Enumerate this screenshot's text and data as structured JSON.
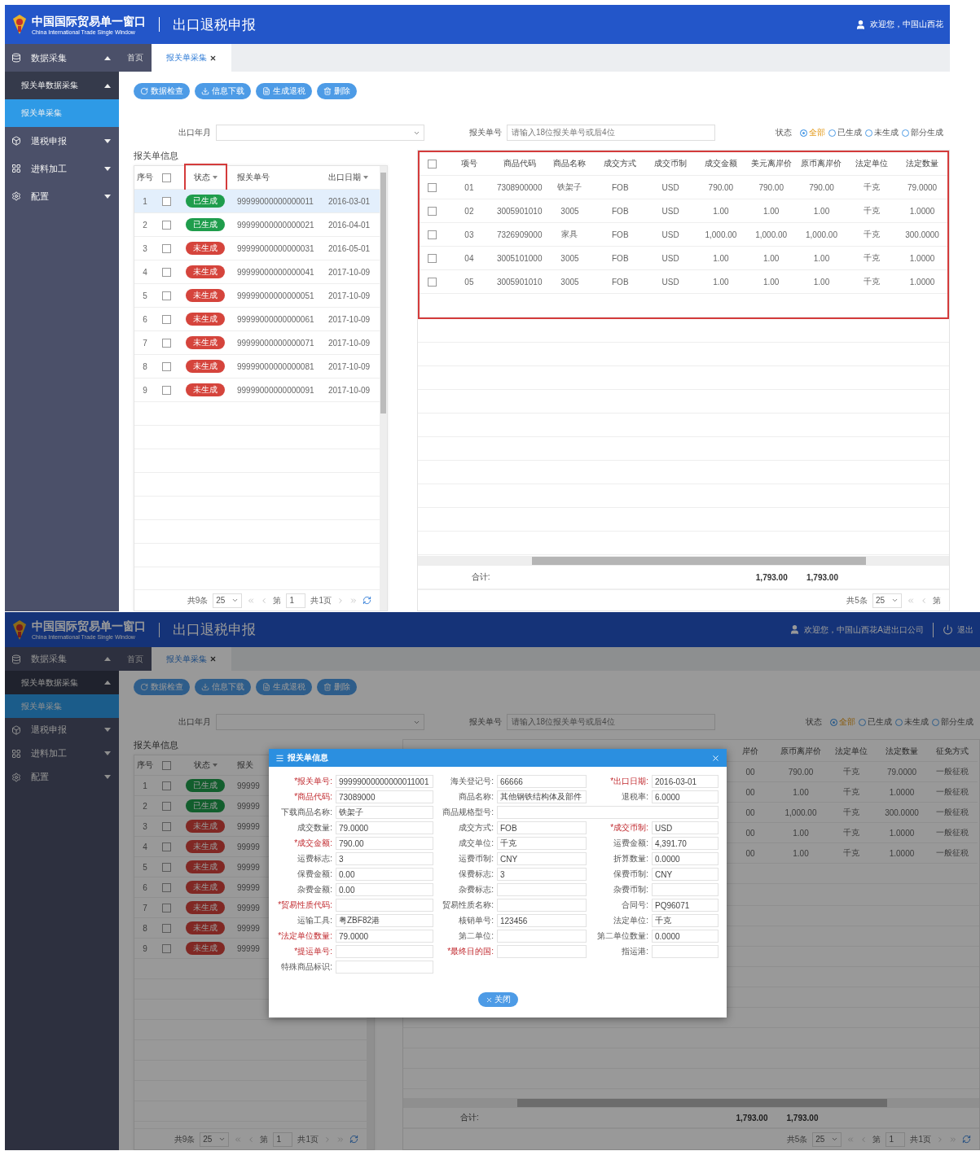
{
  "screens": [
    {
      "header": {
        "logo_title": "中国国际贸易单一窗口",
        "logo_subtitle": "China International Trade Single Window",
        "title": "出口退税申报",
        "user": "欢迎您，中国山西花"
      },
      "sidebar": {
        "items": [
          {
            "label": "数据采集",
            "expanded": true,
            "selected": false,
            "children": [
              {
                "label": "报关单数据采集",
                "expanded": true,
                "selected": false,
                "children": [
                  {
                    "label": "报关单采集",
                    "selected": true
                  }
                ]
              }
            ]
          },
          {
            "label": "退税申报",
            "expanded": false,
            "selected": false
          },
          {
            "label": "进料加工",
            "expanded": false,
            "selected": false
          },
          {
            "label": "配置",
            "expanded": false,
            "selected": false
          }
        ]
      },
      "tabs": [
        {
          "label": "首页",
          "selected": false,
          "closable": false
        },
        {
          "label": "报关单采集",
          "selected": true,
          "closable": true
        }
      ],
      "toolbar": [
        {
          "label": "数据检查"
        },
        {
          "label": "信息下载"
        },
        {
          "label": "生成退税"
        },
        {
          "label": "删除"
        }
      ],
      "filters": {
        "month": {
          "label": "出口年月"
        },
        "number": {
          "label": "报关单号",
          "placeholder": "请输入18位报关单号或后4位"
        },
        "status": {
          "label": "状态",
          "options": [
            {
              "label": "全部",
              "selected": true
            },
            {
              "label": "已生成",
              "selected": false
            },
            {
              "label": "未生成",
              "selected": false
            },
            {
              "label": "部分生成",
              "selected": false
            }
          ]
        }
      },
      "left_table": {
        "title": "报关单信息",
        "columns": [
          {
            "kind": "text",
            "label": "序号",
            "sortable": false,
            "highlighted": false
          },
          {
            "kind": "checkbox",
            "checked": false
          },
          {
            "kind": "status",
            "label": "状态",
            "sortable": true,
            "highlighted": true
          },
          {
            "kind": "text",
            "label": "报关单号",
            "sortable": false,
            "highlighted": false
          },
          {
            "kind": "text",
            "label": "出口日期",
            "sortable": true,
            "highlighted": false
          }
        ],
        "rows": [
          {
            "checked": false,
            "selected": true,
            "status": "已生成",
            "color": "#1f9d4c",
            "cells": [
              "1",
              "99999000000000011",
              "2016-03-01"
            ]
          },
          {
            "checked": false,
            "selected": false,
            "status": "已生成",
            "color": "#1f9d4c",
            "cells": [
              "2",
              "99999000000000021",
              "2016-04-01"
            ]
          },
          {
            "checked": false,
            "selected": false,
            "status": "未生成",
            "color": "#d5443c",
            "cells": [
              "3",
              "99999000000000031",
              "2016-05-01"
            ]
          },
          {
            "checked": false,
            "selected": false,
            "status": "未生成",
            "color": "#d5443c",
            "cells": [
              "4",
              "99999000000000041",
              "2017-10-09"
            ]
          },
          {
            "checked": false,
            "selected": false,
            "status": "未生成",
            "color": "#d5443c",
            "cells": [
              "5",
              "99999000000000051",
              "2017-10-09"
            ]
          },
          {
            "checked": false,
            "selected": false,
            "status": "未生成",
            "color": "#d5443c",
            "cells": [
              "6",
              "99999000000000061",
              "2017-10-09"
            ]
          },
          {
            "checked": false,
            "selected": false,
            "status": "未生成",
            "color": "#d5443c",
            "cells": [
              "7",
              "99999000000000071",
              "2017-10-09"
            ]
          },
          {
            "checked": false,
            "selected": false,
            "status": "未生成",
            "color": "#d5443c",
            "cells": [
              "8",
              "99999000000000081",
              "2017-10-09"
            ]
          },
          {
            "checked": false,
            "selected": false,
            "status": "未生成",
            "color": "#d5443c",
            "cells": [
              "9",
              "99999000000000091",
              "2017-10-09"
            ]
          }
        ],
        "pager": {
          "total": "共9条",
          "page_size": "25",
          "page_prefix": "第",
          "page": "1",
          "pages": "共1页"
        }
      },
      "right_table": {
        "highlighted": true,
        "select_all": {
          "checked": false
        },
        "columns": [
          {
            "label": "项号"
          },
          {
            "label": "商品代码"
          },
          {
            "label": "商品名称"
          },
          {
            "label": "成交方式"
          },
          {
            "label": "成交币制"
          },
          {
            "label": "成交金额"
          },
          {
            "label": "美元离岸价",
            "total": "1,793.00"
          },
          {
            "label": "原币离岸价",
            "total": "1,793.00"
          },
          {
            "label": "法定单位"
          },
          {
            "label": "法定数量"
          }
        ],
        "rows": [
          {
            "checked": false,
            "cells": [
              "01",
              "7308900000",
              "铁架子",
              "FOB",
              "USD",
              "790.00",
              "790.00",
              "790.00",
              "千克",
              "79.0000"
            ]
          },
          {
            "checked": false,
            "cells": [
              "02",
              "3005901010",
              "3005",
              "FOB",
              "USD",
              "1.00",
              "1.00",
              "1.00",
              "千克",
              "1.0000"
            ]
          },
          {
            "checked": false,
            "cells": [
              "03",
              "7326909000",
              "家具",
              "FOB",
              "USD",
              "1,000.00",
              "1,000.00",
              "1,000.00",
              "千克",
              "300.0000"
            ]
          },
          {
            "checked": false,
            "cells": [
              "04",
              "3005101000",
              "3005",
              "FOB",
              "USD",
              "1.00",
              "1.00",
              "1.00",
              "千克",
              "1.0000"
            ]
          },
          {
            "checked": false,
            "cells": [
              "05",
              "3005901010",
              "3005",
              "FOB",
              "USD",
              "1.00",
              "1.00",
              "1.00",
              "千克",
              "1.0000"
            ]
          }
        ],
        "total_label": "合计:",
        "pager": {
          "total": "共5条",
          "page_size": "25",
          "page_prefix": "第"
        }
      }
    },
    {
      "header": {
        "logo_title": "中国国际贸易单一窗口",
        "logo_subtitle": "China International Trade Single Window",
        "title": "出口退税申报",
        "user": "欢迎您，中国山西花A进出口公司",
        "logout": "退出"
      },
      "sidebar": {
        "items": [
          {
            "label": "数据采集",
            "expanded": true,
            "selected": false,
            "children": [
              {
                "label": "报关单数据采集",
                "expanded": true,
                "selected": false,
                "children": [
                  {
                    "label": "报关单采集",
                    "selected": true
                  }
                ]
              }
            ]
          },
          {
            "label": "退税申报",
            "expanded": false,
            "selected": false
          },
          {
            "label": "进料加工",
            "expanded": false,
            "selected": false
          },
          {
            "label": "配置",
            "expanded": false,
            "selected": false
          }
        ]
      },
      "tabs": [
        {
          "label": "首页",
          "selected": false,
          "closable": false
        },
        {
          "label": "报关单采集",
          "selected": true,
          "closable": true
        }
      ],
      "toolbar": [
        {
          "label": "数据检查"
        },
        {
          "label": "信息下载"
        },
        {
          "label": "生成退税"
        },
        {
          "label": "删除"
        }
      ],
      "filters": {
        "month": {
          "label": "出口年月"
        },
        "number": {
          "label": "报关单号",
          "placeholder": "请输入18位报关单号或后4位"
        },
        "status": {
          "label": "状态",
          "options": [
            {
              "label": "全部",
              "selected": true
            },
            {
              "label": "已生成",
              "selected": false
            },
            {
              "label": "未生成",
              "selected": false
            },
            {
              "label": "部分生成",
              "selected": false
            }
          ]
        }
      },
      "left_table": {
        "title": "报关单信息",
        "columns": [
          {
            "kind": "text",
            "label": "序号",
            "sortable": false,
            "highlighted": false
          },
          {
            "kind": "checkbox",
            "checked": false
          },
          {
            "kind": "status",
            "label": "状态",
            "sortable": true,
            "highlighted": false
          },
          {
            "kind": "text",
            "label": "报关",
            "sortable": false,
            "highlighted": false
          }
        ],
        "rows": [
          {
            "checked": false,
            "status": "已生成",
            "kind": "generated",
            "cells": [
              "1",
              "99999"
            ]
          },
          {
            "checked": false,
            "status": "已生成",
            "kind": "generated",
            "cells": [
              "2",
              "99999"
            ]
          },
          {
            "checked": false,
            "status": "未生成",
            "kind": "pending",
            "cells": [
              "3",
              "99999"
            ]
          },
          {
            "checked": false,
            "status": "未生成",
            "kind": "pending",
            "cells": [
              "4",
              "99999"
            ]
          },
          {
            "checked": false,
            "status": "未生成",
            "kind": "pending",
            "cells": [
              "5",
              "99999"
            ]
          },
          {
            "checked": false,
            "status": "未生成",
            "kind": "pending",
            "cells": [
              "6",
              "99999"
            ]
          },
          {
            "checked": false,
            "status": "未生成",
            "kind": "pending",
            "cells": [
              "7",
              "99999"
            ]
          },
          {
            "checked": false,
            "status": "未生成",
            "kind": "pending",
            "cells": [
              "8",
              "99999"
            ]
          },
          {
            "checked": false,
            "status": "未生成",
            "kind": "pending",
            "cells": [
              "9",
              "99999"
            ]
          }
        ],
        "pager": {
          "total": "共9条",
          "page_size": "25",
          "page_prefix": "第",
          "page": "1",
          "pages": "共1页"
        }
      },
      "right_table": {
        "highlighted": false,
        "columns": [
          {
            "label": "岸价",
            "total": "1,793.00"
          },
          {
            "label": "原币离岸价",
            "total": "1,793.00"
          },
          {
            "label": "法定单位"
          },
          {
            "label": "法定数量"
          },
          {
            "label": "征免方式"
          }
        ],
        "rows": [
          {
            "cells": [
              "00",
              "790.00",
              "千克",
              "79.0000",
              "一般征税"
            ]
          },
          {
            "cells": [
              "00",
              "1.00",
              "千克",
              "1.0000",
              "一般征税"
            ]
          },
          {
            "cells": [
              "00",
              "1,000.00",
              "千克",
              "300.0000",
              "一般征税"
            ]
          },
          {
            "cells": [
              "00",
              "1.00",
              "千克",
              "1.0000",
              "一般征税"
            ]
          },
          {
            "cells": [
              "00",
              "1.00",
              "千克",
              "1.0000",
              "一般征税"
            ]
          }
        ],
        "total_label": "合计:",
        "pager": {
          "total": "共5条",
          "page_size": "25",
          "page_prefix": "第",
          "page": "1",
          "pages": "共1页"
        }
      },
      "dialog": {
        "title": "报关单信息",
        "close_label": "关闭",
        "fields": [
          {
            "label": "*报关单号:",
            "required": true,
            "kind": "text",
            "value": "99999000000000011001"
          },
          {
            "label": "海关登记号:",
            "required": false,
            "kind": "text",
            "value": "66666"
          },
          {
            "label": "*出口日期:",
            "required": true,
            "kind": "text",
            "value": "2016-03-01"
          },
          {
            "label": "*商品代码:",
            "required": true,
            "kind": "text",
            "value": "73089000"
          },
          {
            "label": "商品名称:",
            "required": false,
            "kind": "text",
            "value": "其他钢铁结构体及部件"
          },
          {
            "label": "退税率:",
            "required": false,
            "kind": "text",
            "value": "6.0000"
          },
          {
            "label": "下载商品名称:",
            "required": false,
            "kind": "text",
            "value": "铁架子"
          },
          {
            "label": "商品规格型号:",
            "required": false,
            "kind": "wide"
          },
          {
            "label": "成交数量:",
            "required": false,
            "kind": "text",
            "value": "79.0000"
          },
          {
            "label": "成交方式:",
            "required": false,
            "kind": "text",
            "value": "FOB"
          },
          {
            "label": "*成交币制:",
            "required": true,
            "kind": "text",
            "value": "USD"
          },
          {
            "label": "*成交金额:",
            "required": true,
            "kind": "text",
            "value": "790.00"
          },
          {
            "label": "成交单位:",
            "required": false,
            "kind": "text",
            "value": "千克"
          },
          {
            "label": "运费金额:",
            "required": false,
            "kind": "text",
            "value": "4,391.70"
          },
          {
            "label": "运费标志:",
            "required": false,
            "kind": "text",
            "value": "3"
          },
          {
            "label": "运费币制:",
            "required": false,
            "kind": "text",
            "value": "CNY"
          },
          {
            "label": "折算数量:",
            "required": false,
            "kind": "text",
            "value": "0.0000"
          },
          {
            "label": "保费金额:",
            "required": false,
            "kind": "text",
            "value": "0.00"
          },
          {
            "label": "保费标志:",
            "required": false,
            "kind": "text",
            "value": "3"
          },
          {
            "label": "保费币制:",
            "required": false,
            "kind": "text",
            "value": "CNY"
          },
          {
            "label": "杂费金额:",
            "required": false,
            "kind": "text",
            "value": "0.00"
          },
          {
            "label": "杂费标志:",
            "required": false,
            "kind": "text"
          },
          {
            "label": "杂费币制:",
            "required": false,
            "kind": "text"
          },
          {
            "label": "*贸易性质代码:",
            "required": true,
            "kind": "text"
          },
          {
            "label": "贸易性质名称:",
            "required": false,
            "kind": "text"
          },
          {
            "label": "合同号:",
            "required": false,
            "kind": "text",
            "value": "PQ96071"
          },
          {
            "label": "运输工具:",
            "required": false,
            "kind": "text",
            "value": "粤ZBF82港"
          },
          {
            "label": "核销单号:",
            "required": false,
            "kind": "text",
            "value": "123456"
          },
          {
            "label": "法定单位:",
            "required": false,
            "kind": "text",
            "value": "千克"
          },
          {
            "label": "*法定单位数量:",
            "required": true,
            "kind": "text",
            "value": "79.0000"
          },
          {
            "label": "第二单位:",
            "required": false,
            "kind": "text"
          },
          {
            "label": "第二单位数量:",
            "required": false,
            "kind": "text",
            "value": "0.0000"
          },
          {
            "label": "*提运单号:",
            "required": true,
            "kind": "text"
          },
          {
            "label": "*最终目的国:",
            "required": true,
            "kind": "text"
          },
          {
            "label": "指运港:",
            "required": false,
            "kind": "text"
          },
          {
            "label": "特殊商品标识:",
            "required": false,
            "kind": "text"
          }
        ]
      }
    }
  ]
}
